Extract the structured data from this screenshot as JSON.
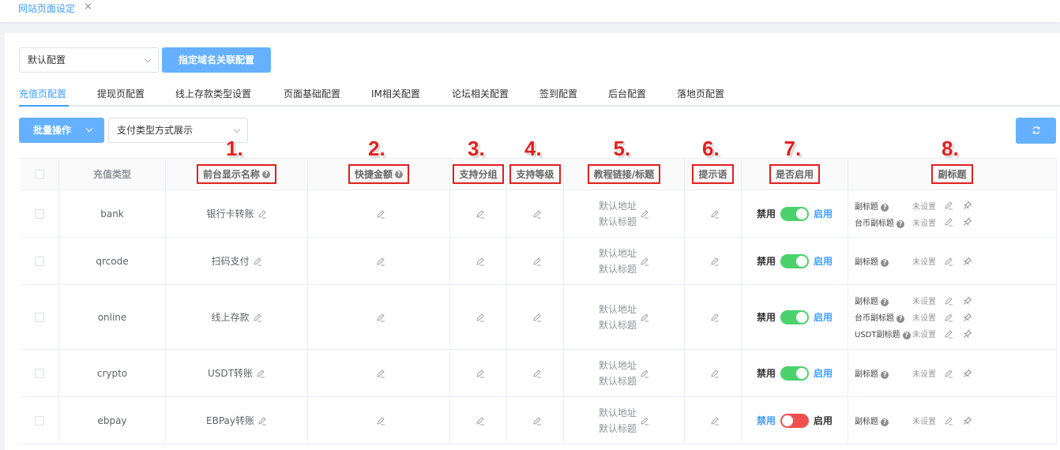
{
  "window": {
    "tab_title": "网站页面设定",
    "close_glyph": "×"
  },
  "toolbar": {
    "config_select": "默认配置",
    "domain_button": "指定域名关联配置",
    "batch_button": "批量操作",
    "display_select": "支付类型方式展示"
  },
  "tabs": [
    "充值页配置",
    "提现页配置",
    "线上存款类型设置",
    "页面基础配置",
    "IM相关配置",
    "论坛相关配置",
    "签到配置",
    "后台配置",
    "落地页配置"
  ],
  "active_tab": "充值页配置",
  "table": {
    "headers": {
      "type": "充值类型",
      "display_name": "前台显示名称",
      "quick_amount": "快捷金额",
      "group": "支持分组",
      "level": "支持等级",
      "tutorial": "教程链接/标题",
      "hint": "提示语",
      "enabled": "是否启用",
      "subtitle": "副标题"
    },
    "markers": [
      "1.",
      "2.",
      "3.",
      "4.",
      "5.",
      "6.",
      "7.",
      "8."
    ],
    "disable_label": "禁用",
    "enable_label": "启用",
    "default_address": "默认地址",
    "default_title": "默认标题",
    "unset_label": "未设置",
    "rows": [
      {
        "type": "bank",
        "name": "银行卡转账",
        "enabled": true,
        "subtitles": [
          "副标题",
          "台币副标题"
        ]
      },
      {
        "type": "qrcode",
        "name": "扫码支付",
        "enabled": true,
        "subtitles": [
          "副标题"
        ]
      },
      {
        "type": "online",
        "name": "线上存款",
        "enabled": true,
        "subtitles": [
          "副标题",
          "台币副标题",
          "USDT副标题"
        ]
      },
      {
        "type": "crypto",
        "name": "USDT转账",
        "enabled": true,
        "subtitles": [
          "副标题"
        ]
      },
      {
        "type": "ebpay",
        "name": "EBPay转账",
        "enabled": false,
        "subtitles": [
          "副标题"
        ]
      }
    ]
  },
  "colors": {
    "primary": "#409eff",
    "button": "#66b1ff",
    "switch_on": "#4cd26c",
    "switch_off": "#f05050",
    "annotation": "#e02020"
  },
  "icons": {
    "edit": "pencil-icon",
    "pin": "pin-icon",
    "help": "question-circle-icon",
    "refresh": "refresh-icon",
    "chevron": "chevron-down-icon"
  }
}
